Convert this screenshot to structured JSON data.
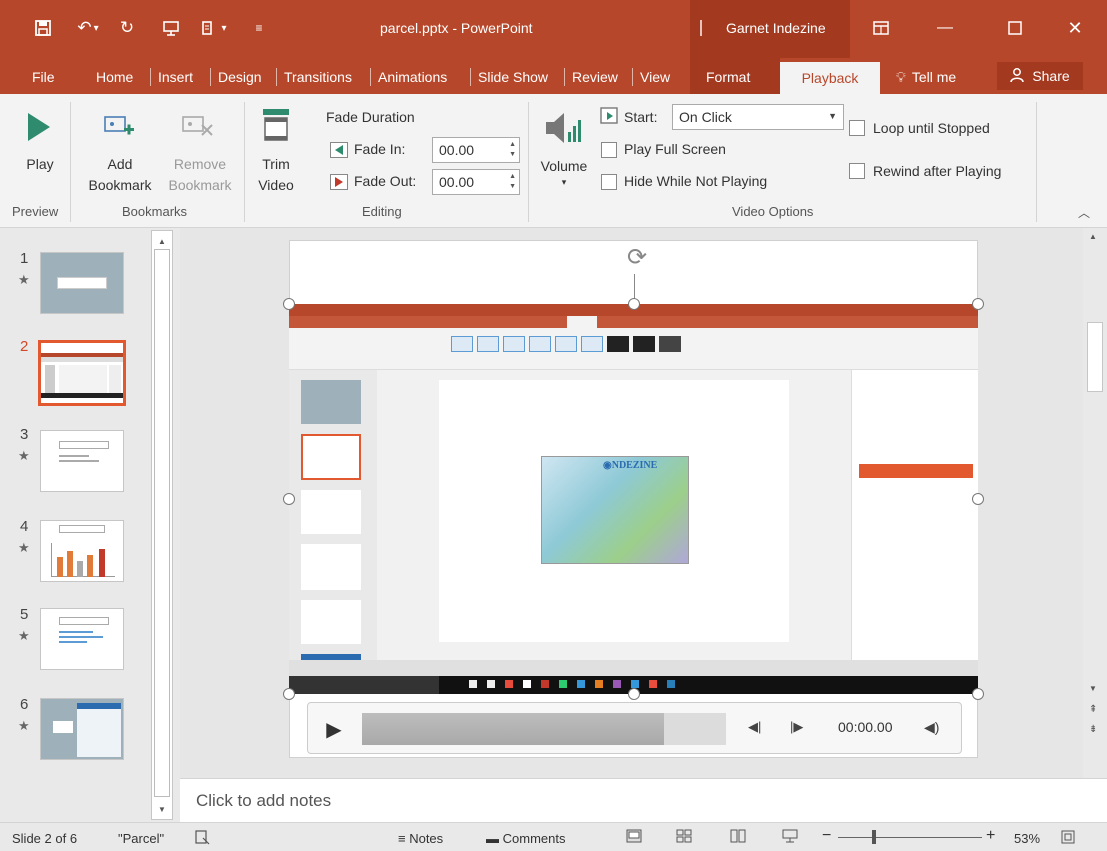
{
  "titlebar": {
    "doc_title": "parcel.pptx - PowerPoint",
    "user_name": "Garnet Indezine",
    "accent": "#b7472a"
  },
  "tabs": {
    "file": "File",
    "home": "Home",
    "insert": "Insert",
    "design": "Design",
    "transitions": "Transitions",
    "animations": "Animations",
    "slideshow": "Slide Show",
    "review": "Review",
    "view": "View",
    "format": "Format",
    "playback": "Playback",
    "tellme": "Tell me",
    "share": "Share"
  },
  "ribbon": {
    "preview": {
      "play": "Play",
      "group": "Preview"
    },
    "bookmarks": {
      "add_1": "Add",
      "add_2": "Bookmark",
      "remove_1": "Remove",
      "remove_2": "Bookmark",
      "group": "Bookmarks"
    },
    "editing": {
      "trim_1": "Trim",
      "trim_2": "Video",
      "fade_duration": "Fade Duration",
      "fade_in_label": "Fade In:",
      "fade_in_value": "00.00",
      "fade_out_label": "Fade Out:",
      "fade_out_value": "00.00",
      "group": "Editing"
    },
    "video_options": {
      "volume": "Volume",
      "start_label": "Start:",
      "start_value": "On Click",
      "play_full_screen": "Play Full Screen",
      "hide_while_not_playing": "Hide While Not Playing",
      "loop_until_stopped": "Loop until Stopped",
      "rewind_after_playing": "Rewind after Playing",
      "group": "Video Options"
    }
  },
  "slides": [
    {
      "num": "1"
    },
    {
      "num": "2"
    },
    {
      "num": "3"
    },
    {
      "num": "4"
    },
    {
      "num": "5"
    },
    {
      "num": "6"
    }
  ],
  "player": {
    "time": "00:00.00",
    "progress": 0.83
  },
  "notes": {
    "placeholder": "Click to add notes"
  },
  "status": {
    "slide_of": "Slide 2 of 6",
    "theme": "\"Parcel\"",
    "notes": "Notes",
    "comments": "Comments",
    "zoom": "53%"
  }
}
